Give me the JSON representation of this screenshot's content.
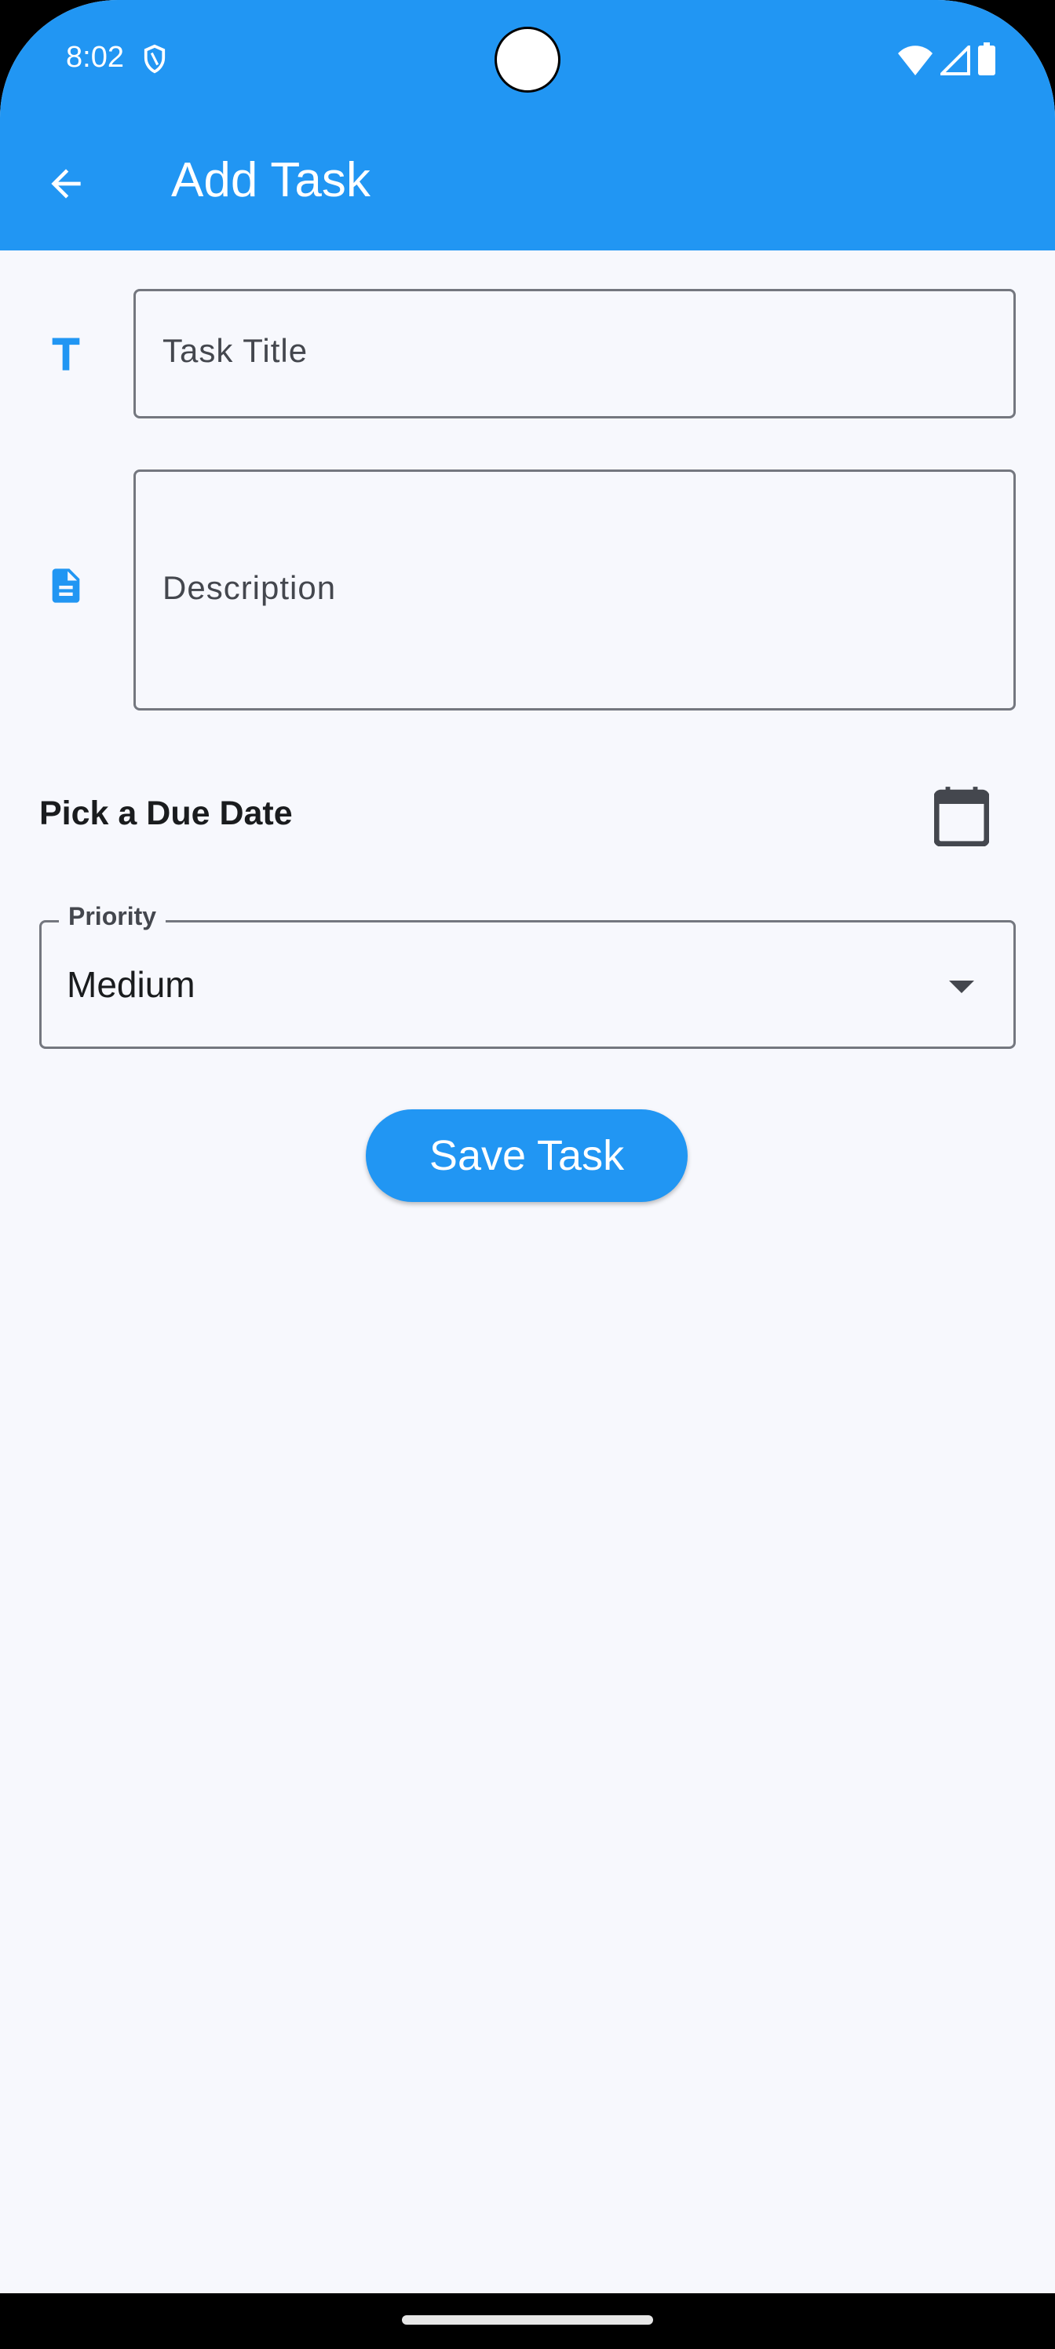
{
  "status_bar": {
    "time": "8:02",
    "icons": [
      "shield-icon",
      "wifi-icon",
      "signal-icon",
      "battery-icon"
    ]
  },
  "app_bar": {
    "title": "Add Task",
    "back_icon": "arrow-back-icon",
    "color": "#2196f3"
  },
  "form": {
    "title_field": {
      "placeholder": "Task Title",
      "icon": "title-icon"
    },
    "description_field": {
      "placeholder": "Description",
      "icon": "description-icon"
    },
    "due_date": {
      "label": "Pick a Due Date",
      "icon": "calendar-icon"
    },
    "priority": {
      "label": "Priority",
      "value": "Medium"
    },
    "save_label": "Save Task"
  }
}
